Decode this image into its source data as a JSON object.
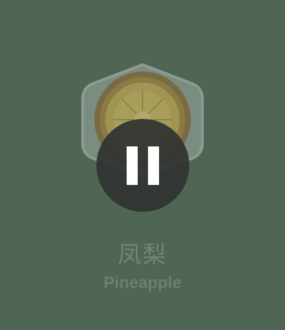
{
  "card": {
    "image_icon": "pineapple-slice-icon",
    "pause_icon": "pause-icon",
    "word_chinese": "凤梨",
    "word_english": "Pineapple"
  },
  "colors": {
    "background": "#4e6653",
    "overlay": "#303431",
    "text": "#728675"
  }
}
